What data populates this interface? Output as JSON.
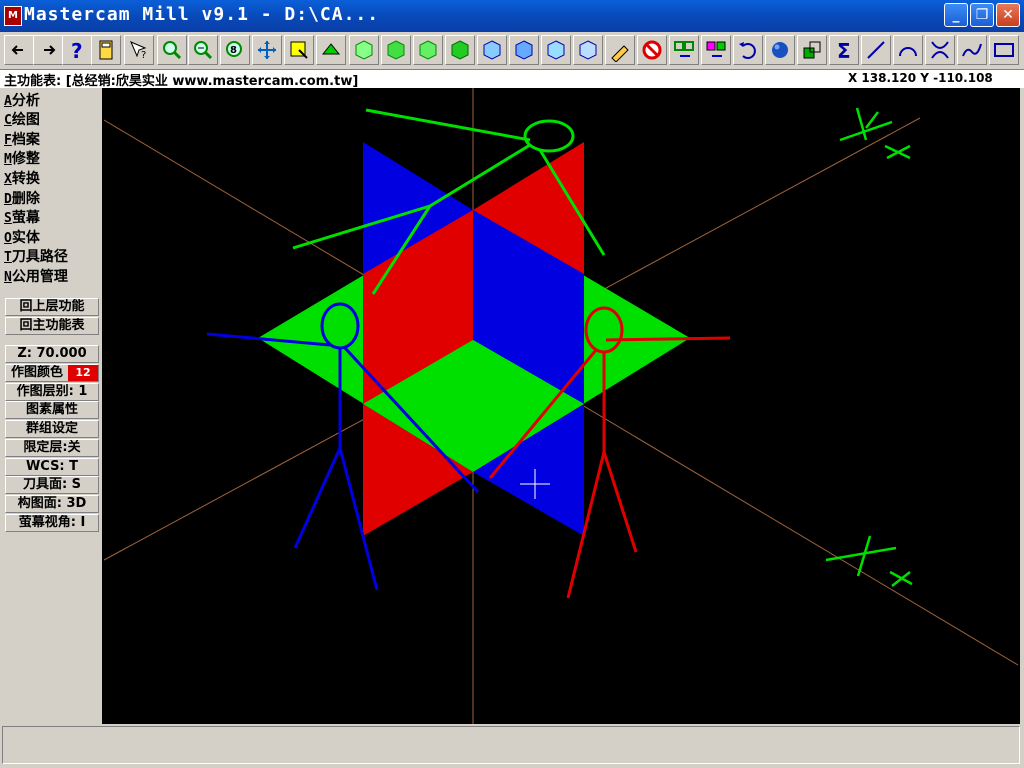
{
  "window": {
    "title": "Mastercam Mill v9.1 - D:\\CA...",
    "app_icon_label": "M"
  },
  "toolbar": {
    "buttons": [
      "back-arrow",
      "forward-arrow",
      "help",
      "calculator",
      "pointer-help",
      "zoom",
      "unzoom",
      "zoom-fit",
      "pan",
      "select-box",
      "rotate-view",
      "view-top",
      "view-front",
      "view-side",
      "view-iso",
      "cube-blue-1",
      "cube-blue-2",
      "cube-blue-3",
      "cube-blue-4",
      "eraser",
      "no-entry",
      "move-cut",
      "copy-cut",
      "undo",
      "sphere",
      "layer",
      "sigma",
      "line",
      "arc",
      "trim",
      "spline",
      "rectangle"
    ]
  },
  "status": {
    "menu_title": "主功能表: [总经销:欣昊实业 www.mastercam.com.tw]",
    "coords": "X 138.120  Y -110.108"
  },
  "main_menu": [
    {
      "key": "A",
      "label": "分析"
    },
    {
      "key": "C",
      "label": "绘图"
    },
    {
      "key": "F",
      "label": "档案"
    },
    {
      "key": "M",
      "label": "修整"
    },
    {
      "key": "X",
      "label": "转换"
    },
    {
      "key": "D",
      "label": "删除"
    },
    {
      "key": "S",
      "label": "萤幕"
    },
    {
      "key": "O",
      "label": "实体"
    },
    {
      "key": "T",
      "label": "刀具路径"
    },
    {
      "key": "N",
      "label": "公用管理"
    }
  ],
  "nav_buttons": {
    "back_level": "回上层功能",
    "main_menu": "回主功能表"
  },
  "settings": {
    "z_depth": "Z: 70.000",
    "color_label": "作图颜色",
    "color_value": "12",
    "level": "作图层别: 1",
    "attributes": "图素属性",
    "group": "群组设定",
    "mask": "限定层:关",
    "wcs": "WCS: T",
    "tool_plane": "刀具面: S",
    "construction_plane": "构图面: 3D",
    "screen_view": "萤幕视角: I"
  },
  "colors": {
    "blue": "#0000e0",
    "red": "#e00000",
    "green": "#00e000",
    "axis": "#a0643c",
    "background": "#000000"
  },
  "prompt": ""
}
